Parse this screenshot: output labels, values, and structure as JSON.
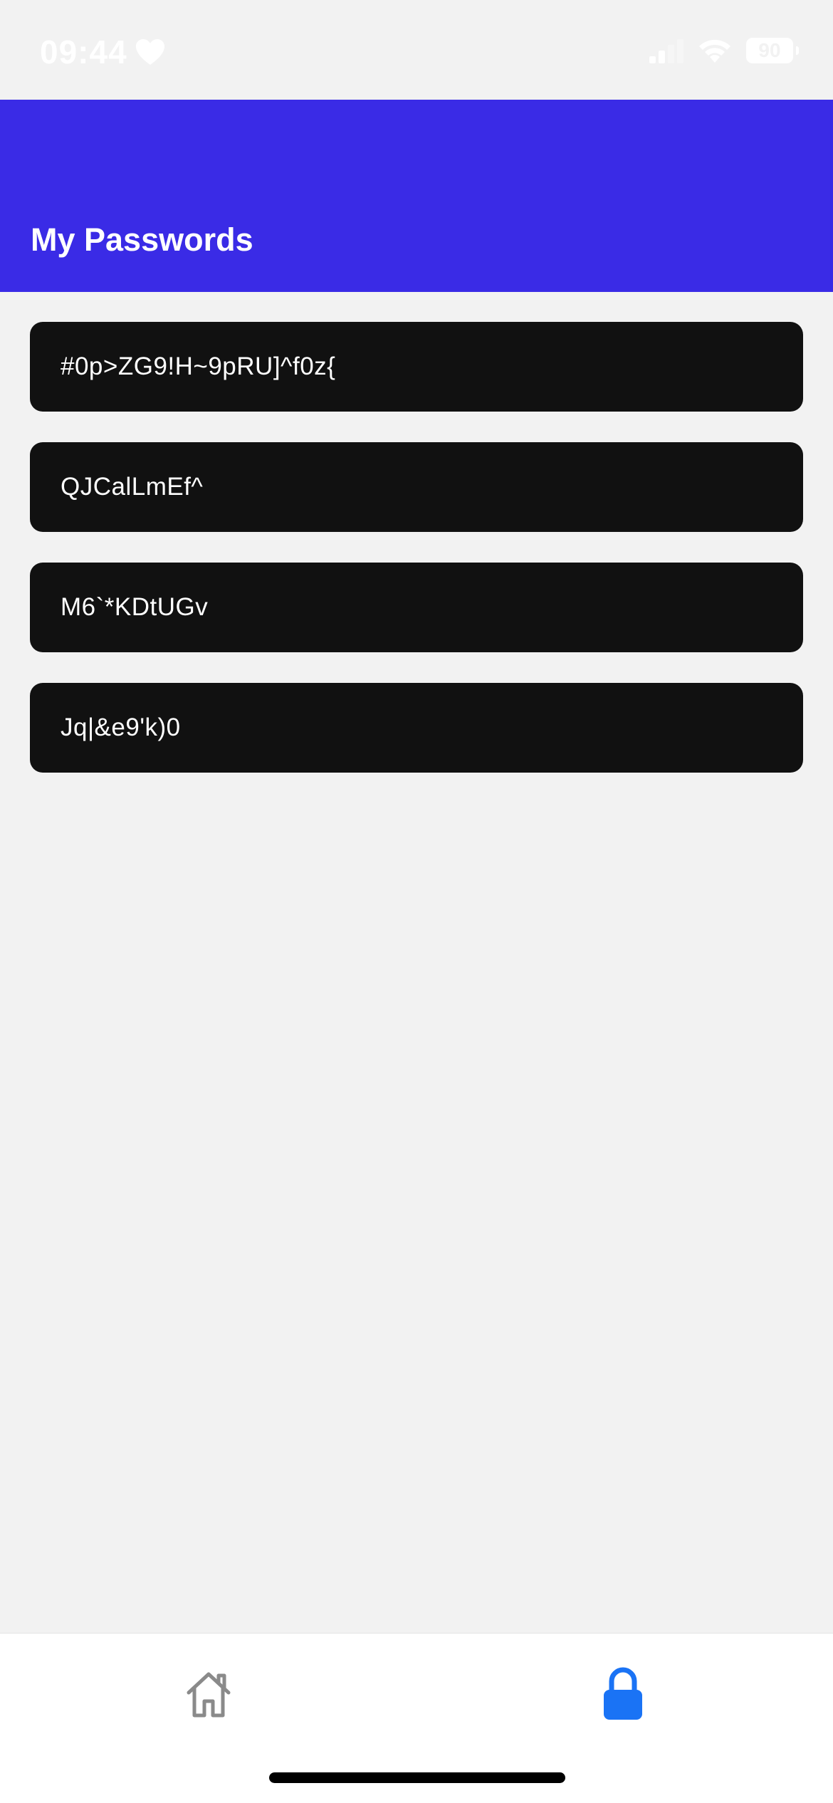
{
  "status_bar": {
    "time": "09:44",
    "battery_level": "90",
    "icons": [
      "heart-icon",
      "signal-icon",
      "wifi-icon",
      "battery-icon"
    ]
  },
  "header": {
    "title": "My Passwords",
    "color": "#3a2be6"
  },
  "passwords": [
    "#0p>ZG9!H~9pRU]^f0z{",
    "QJCalLmEf^",
    "M6`*KDtUGv",
    "Jq|&e9'k)0"
  ],
  "tab_bar": {
    "tabs": [
      {
        "icon": "home-icon",
        "active": false
      },
      {
        "icon": "lock-icon",
        "active": true
      }
    ],
    "active_color": "#1a73f5",
    "inactive_color": "#8a8a8a"
  }
}
